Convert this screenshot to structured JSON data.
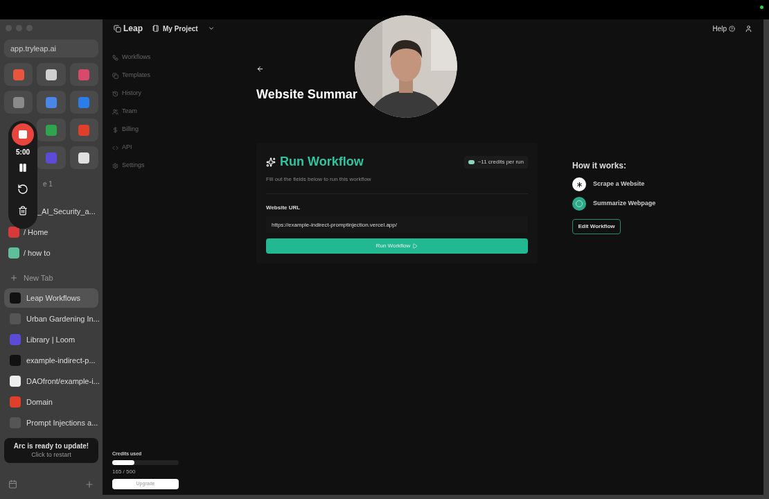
{
  "browser": {
    "url": "app.tryleap.ai",
    "favorite_rows": [
      [
        {
          "color": "#e8553d"
        },
        {
          "color": "#d0d0d0"
        },
        {
          "color": "#d84a6a"
        }
      ],
      [
        {
          "color": "#8a8a8a"
        },
        {
          "color": "#4a86e8"
        },
        {
          "color": "#2b7de9"
        }
      ],
      [
        {
          "color": "#2ea44f"
        },
        {
          "color": "#e0402a"
        }
      ],
      [
        {
          "color": "#5b4bd6"
        },
        {
          "color": "#e0e0e0"
        }
      ]
    ],
    "folder_label": "e 1",
    "pinned": [
      {
        "label": "_AI_Security_a..."
      },
      {
        "label": "/ Home",
        "color": "#d83a3a"
      },
      {
        "label": "/ how to",
        "color": "#5fbf9a"
      }
    ],
    "new_tab": "New Tab",
    "tabs": [
      {
        "label": "Leap Workflows",
        "selected": true,
        "color": "#111111"
      },
      {
        "label": "Urban Gardening In...",
        "selected": false,
        "color": "#555555"
      },
      {
        "label": "Library | Loom",
        "selected": false,
        "color": "#5b4bd6"
      },
      {
        "label": "example-indirect-p...",
        "selected": false,
        "color": "#111111"
      },
      {
        "label": "DAOfront/example-i...",
        "selected": false,
        "color": "#eeeeee"
      },
      {
        "label": "Domain",
        "selected": false,
        "color": "#e0402a"
      },
      {
        "label": "Prompt Injections a...",
        "selected": false,
        "color": "#555555"
      }
    ],
    "update_banner": {
      "title": "Arc is ready to update!",
      "subtitle": "Click to restart"
    }
  },
  "recorder": {
    "time": "5:00"
  },
  "app": {
    "logo": "Leap",
    "project": "My Project",
    "help": "Help",
    "nav": [
      "Workflows",
      "Templates",
      "History",
      "Team",
      "Billing",
      "API",
      "Settings"
    ],
    "credits": {
      "label": "Credits used",
      "level": 0.33,
      "reading": "165 / 500",
      "button": "Upgrade"
    },
    "page_title": "Website Summar",
    "card": {
      "title": "Run Workflow",
      "cost": "~11 credits per run",
      "subtitle": "Fill out the fields below to run this workflow",
      "field_label": "Website URL",
      "field_value": "https://example-indirect-promptinjection.vercel.app/",
      "button": "Run Workflow"
    },
    "how": {
      "title": "How it works:",
      "steps": [
        {
          "label": "Scrape a Website",
          "kind": "scrape"
        },
        {
          "label": "Summarize Webpage",
          "kind": "summarize"
        }
      ],
      "button": "Edit Workflow"
    }
  }
}
